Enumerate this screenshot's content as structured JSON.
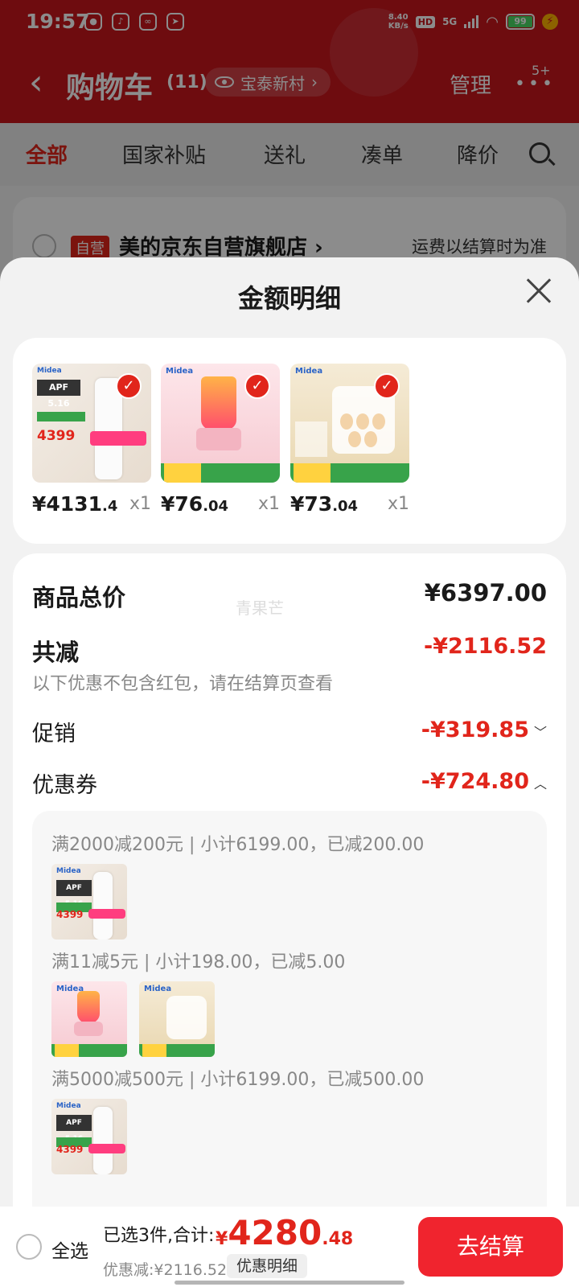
{
  "status_bar": {
    "time": "19:57",
    "net_speed_value": "8.40",
    "net_speed_unit": "KB/s",
    "hd": "HD",
    "network": "5G",
    "battery": "99",
    "app_icons": [
      "wechat-icon",
      "douyin-icon",
      "app-icon",
      "mail-icon"
    ]
  },
  "nav": {
    "back_icon": "chevron-left-icon",
    "title": "购物车",
    "count": "(11)",
    "location": "宝泰新村",
    "location_chevron": "›",
    "manage": "管理",
    "more_badge": "5+"
  },
  "tabs": [
    {
      "label": "全部",
      "active": true
    },
    {
      "label": "国家补贴",
      "active": false
    },
    {
      "label": "送礼",
      "active": false
    },
    {
      "label": "凑单",
      "active": false
    },
    {
      "label": "降价",
      "active": false
    }
  ],
  "store": {
    "tag": "自营",
    "name": "美的京东自营旗舰店 ›",
    "shipping": "运费以结算时为准"
  },
  "sheet": {
    "title": "金额明细",
    "items": [
      {
        "name": "air-conditioner",
        "price_int": "¥4131",
        "price_dec": ".4",
        "qty": "x1"
      },
      {
        "name": "blender",
        "price_int": "¥76",
        "price_dec": ".04",
        "qty": "x1"
      },
      {
        "name": "egg-steamer",
        "price_int": "¥73",
        "price_dec": ".04",
        "qty": "x1"
      }
    ],
    "watermark": "青果芒",
    "total_label": "商品总价",
    "total_value": "¥6397.00",
    "reduce_label": "共减",
    "reduce_value": "-¥2116.52",
    "reduce_note": "以下优惠不包含红包，请在结算页查看",
    "promo_label": "促销",
    "promo_value": "-¥319.85",
    "coupon_label": "优惠券",
    "coupon_value": "-¥724.80",
    "coupons": [
      {
        "text": "满2000减200元 | 小计6199.00，已减200.00"
      },
      {
        "text": "满11减5元 | 小计198.00，已减5.00"
      },
      {
        "text": "满5000减500元 | 小计6199.00，已减500.00"
      }
    ]
  },
  "bottom": {
    "select_all": "全选",
    "selected_text": "已选3件,合计:",
    "currency": "¥",
    "total_int": "4280",
    "total_dec": ".48",
    "discount_text": "优惠减:¥2116.52",
    "discount_detail": "优惠明细",
    "checkout": "去结算"
  },
  "colors": {
    "brand_red": "#e1251b",
    "header_red": "#c8161d",
    "checkout_red": "#f0242e",
    "tag_green": "#38a34a"
  }
}
